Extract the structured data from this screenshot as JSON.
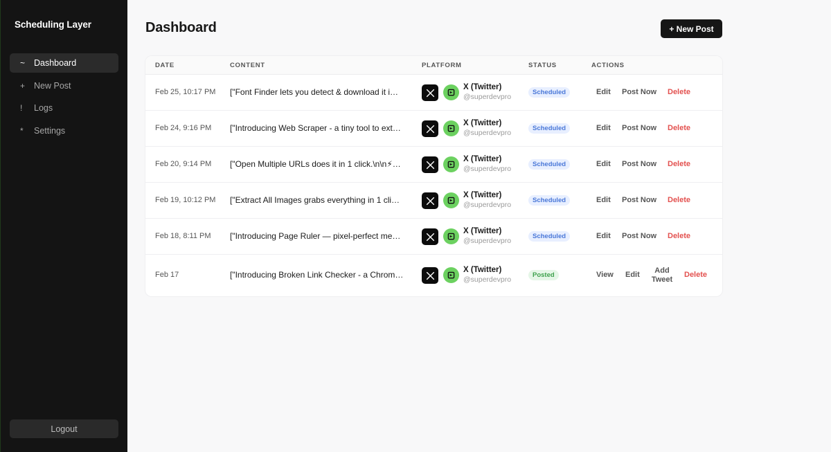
{
  "sidebar": {
    "brand": "Scheduling Layer",
    "items": [
      {
        "icon": "~",
        "label": "Dashboard"
      },
      {
        "icon": "+",
        "label": "New Post"
      },
      {
        "icon": "!",
        "label": "Logs"
      },
      {
        "icon": "*",
        "label": "Settings"
      }
    ],
    "logout": "Logout"
  },
  "header": {
    "title": "Dashboard",
    "new_post": "+ New Post"
  },
  "table": {
    "columns": [
      "DATE",
      "CONTENT",
      "PLATFORM",
      "STATUS",
      "ACTIONS"
    ],
    "rows": [
      {
        "date": "Feb 25, 10:17 PM",
        "content": "[\"Font Finder lets you detect & download it i…",
        "platform": "X (Twitter)",
        "handle": "@superdevpro",
        "status": "Scheduled",
        "actions": [
          "Edit",
          "Post Now",
          "Delete"
        ]
      },
      {
        "date": "Feb 24, 9:16 PM",
        "content": "[\"Introducing Web Scraper - a tiny tool to ext…",
        "platform": "X (Twitter)",
        "handle": "@superdevpro",
        "status": "Scheduled",
        "actions": [
          "Edit",
          "Post Now",
          "Delete"
        ]
      },
      {
        "date": "Feb 20, 9:14 PM",
        "content": "[\"Open Multiple URLs does it in 1 click.\\n\\n⚡…",
        "platform": "X (Twitter)",
        "handle": "@superdevpro",
        "status": "Scheduled",
        "actions": [
          "Edit",
          "Post Now",
          "Delete"
        ]
      },
      {
        "date": "Feb 19, 10:12 PM",
        "content": "[\"Extract All Images grabs everything in 1 cli…",
        "platform": "X (Twitter)",
        "handle": "@superdevpro",
        "status": "Scheduled",
        "actions": [
          "Edit",
          "Post Now",
          "Delete"
        ]
      },
      {
        "date": "Feb 18, 8:11 PM",
        "content": "[\"Introducing Page Ruler — pixel-perfect me…",
        "platform": "X (Twitter)",
        "handle": "@superdevpro",
        "status": "Scheduled",
        "actions": [
          "Edit",
          "Post Now",
          "Delete"
        ]
      },
      {
        "date": "Feb 17",
        "content": "[\"Introducing Broken Link Checker - a Chrom…",
        "platform": "X (Twitter)",
        "handle": "@superdevpro",
        "status": "Posted",
        "actions": [
          "View",
          "Edit",
          "Add\nTweet",
          "Delete"
        ]
      }
    ]
  },
  "colors": {
    "sidebar_bg": "#141414",
    "scheduled_badge": "#4a78d8",
    "posted_badge": "#3fa14e",
    "delete": "#e3514f",
    "app_icon": "#6cd160"
  }
}
